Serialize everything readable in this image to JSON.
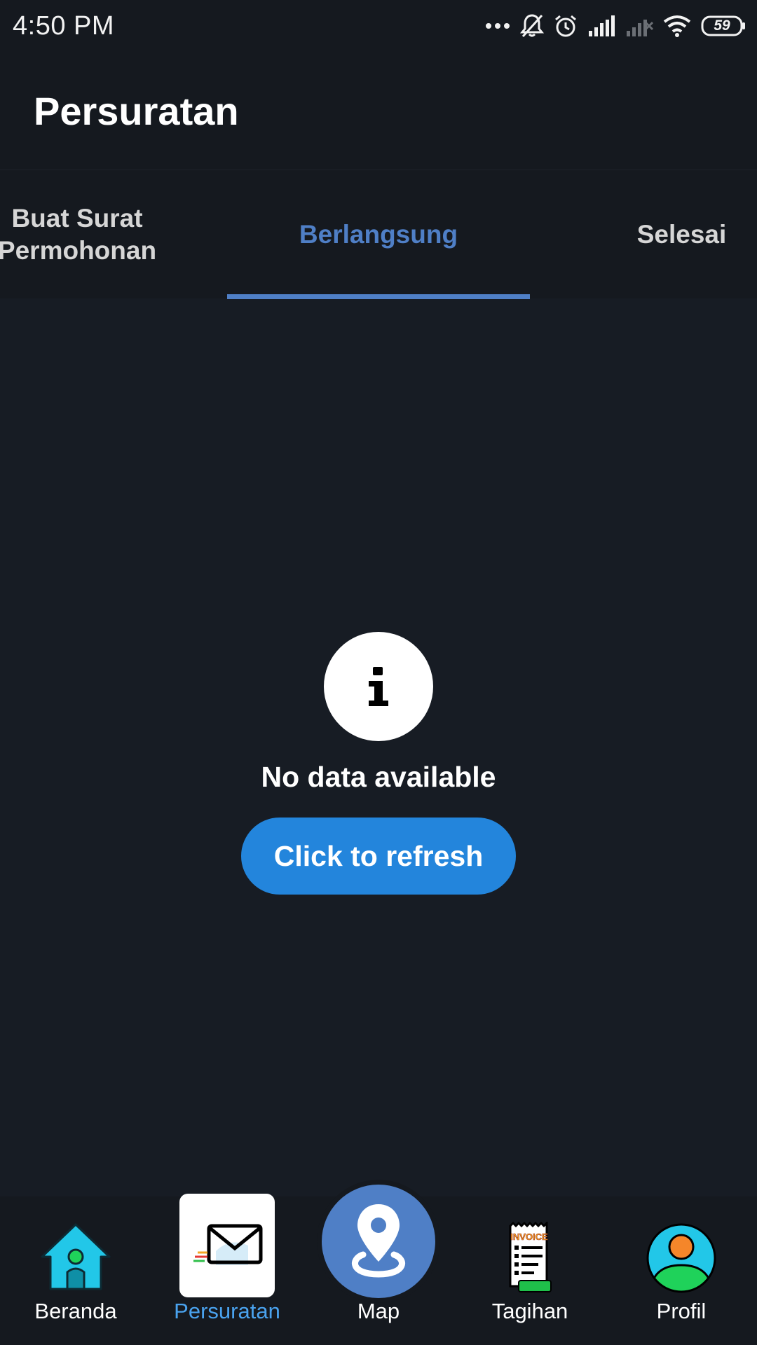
{
  "status_bar": {
    "time": "4:50 PM",
    "battery": "59",
    "icons": [
      "more-dots-icon",
      "bell-off-icon",
      "alarm-icon",
      "signal-icon",
      "signal-off-icon",
      "wifi-icon",
      "battery-icon"
    ]
  },
  "app_bar": {
    "title": "Persuratan"
  },
  "tabs": [
    {
      "line1": "Buat Surat",
      "line2": "Permohonan"
    },
    {
      "label": "Berlangsung",
      "active": true
    },
    {
      "label": "Selesai"
    }
  ],
  "empty_state": {
    "icon": "info-icon",
    "message": "No data available",
    "button_label": "Click to refresh"
  },
  "bottom_nav": [
    {
      "label": "Beranda",
      "icon": "home-icon"
    },
    {
      "label": "Persuratan",
      "icon": "mail-icon",
      "active": true
    },
    {
      "label": "Map",
      "icon": "map-pin-icon"
    },
    {
      "label": "Tagihan",
      "icon": "invoice-icon",
      "icon_text": "INVOICE"
    },
    {
      "label": "Profil",
      "icon": "profile-icon"
    }
  ],
  "colors": {
    "background": "#171c24",
    "bar": "#15191f",
    "accent": "#4f7fc6",
    "button": "#2385dc",
    "active_nav_label": "#4aa3ef"
  }
}
